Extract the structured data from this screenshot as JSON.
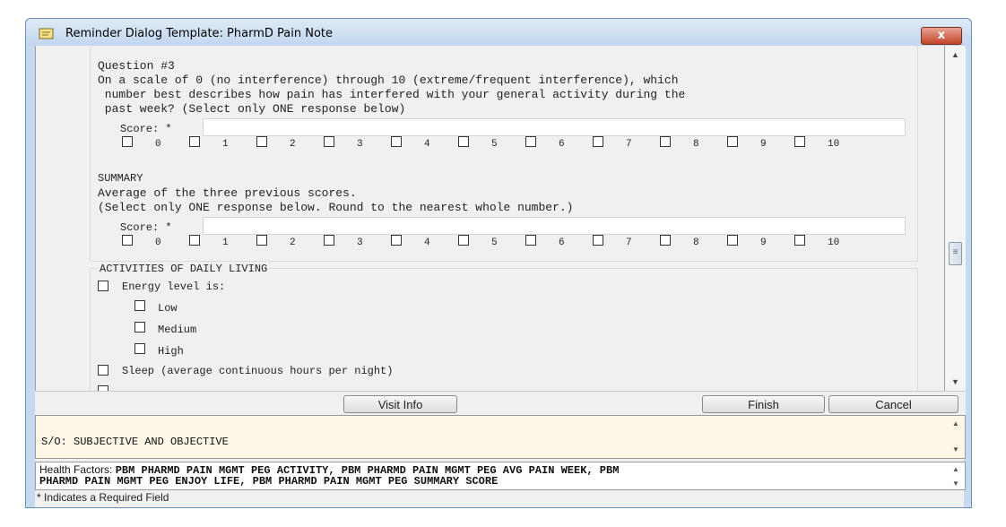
{
  "window": {
    "title": "Reminder Dialog Template: PharmD Pain Note",
    "close_label": "x"
  },
  "question3": {
    "title": "Question #3",
    "lines": [
      "On a scale of 0 (no interference) through 10 (extreme/frequent interference), which",
      " number best describes how pain has interfered with your general activity during the",
      " past week? (Select only ONE response below)"
    ],
    "score_label": "Score: *",
    "score_value": "",
    "options": [
      "0",
      "1",
      "2",
      "3",
      "4",
      "5",
      "6",
      "7",
      "8",
      "9",
      "10"
    ]
  },
  "summary": {
    "title": "SUMMARY",
    "lines": [
      "Average of the three previous scores.",
      "(Select only ONE response below. Round to the nearest whole number.)"
    ],
    "score_label": "Score: *",
    "score_value": "",
    "options": [
      "0",
      "1",
      "2",
      "3",
      "4",
      "5",
      "6",
      "7",
      "8",
      "9",
      "10"
    ]
  },
  "adl": {
    "header": "ACTIVITIES OF DAILY LIVING",
    "energy_label": "Energy level is:",
    "energy_options": [
      "Low",
      "Medium",
      "High"
    ],
    "sleep_label": "Sleep (average continuous hours per night)"
  },
  "buttons": {
    "visit_info": "Visit Info",
    "finish": "Finish",
    "cancel": "Cancel"
  },
  "preview": {
    "text": "S/O: SUBJECTIVE AND OBJECTIVE"
  },
  "health_factors": {
    "label": "Health Factors:",
    "line1": "PBM PHARMD PAIN MGMT PEG ACTIVITY, PBM PHARMD PAIN MGMT PEG AVG PAIN WEEK, PBM",
    "line2": "PHARMD PAIN MGMT PEG ENJOY LIFE, PBM PHARMD PAIN MGMT PEG SUMMARY SCORE"
  },
  "footnote": "* Indicates a Required Field"
}
